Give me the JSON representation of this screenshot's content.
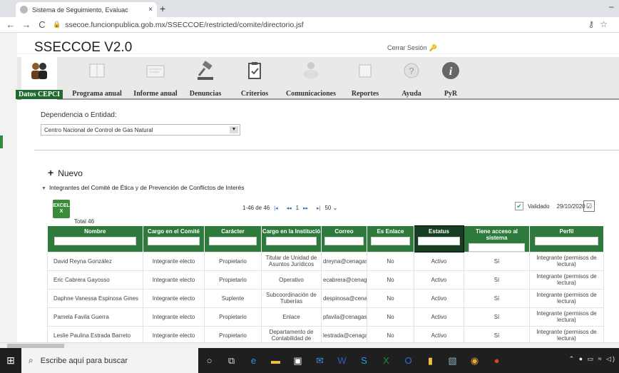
{
  "browser": {
    "tab_title": "Sistema de Seguimiento, Evaluac",
    "tab_close": "×",
    "new_tab": "+",
    "url": "ssecoe.funcionpublica.gob.mx/SSECCOE/restricted/comite/directorio.jsf",
    "window_min": "–"
  },
  "app": {
    "title": "SSECCOE V2.0",
    "logout": "Cerrar Sesión"
  },
  "menu": [
    {
      "label": "Datos CEPCI",
      "icon": "people-icon",
      "selected": true
    },
    {
      "label": "Programa anual",
      "icon": "book-icon"
    },
    {
      "label": "Informe anual",
      "icon": "report-icon"
    },
    {
      "label": "Denuncias",
      "icon": "gavel-icon"
    },
    {
      "label": "Criterios",
      "icon": "clipboard-icon"
    },
    {
      "label": "Comunicaciones",
      "icon": "handshake-icon"
    },
    {
      "label": "Reportes",
      "icon": "folder-icon"
    },
    {
      "label": "Ayuda",
      "icon": "help-icon"
    },
    {
      "label": "PyR",
      "icon": "info-icon"
    }
  ],
  "dependency": {
    "label": "Dependencia o Entidad:",
    "value": "Centro Nacional de Control de Gas Natural"
  },
  "nuevo": "Nuevo",
  "section_title": "Integrantes del Comité de Ética y de Prevención de Conflictos de Interés",
  "excel": {
    "label": "EXCEL",
    "total": "Total 46"
  },
  "pager": {
    "range": "1-46 de 46",
    "first": "|◂",
    "prev": "◂◂",
    "page": "1",
    "next": "▸▸",
    "last": "▸|",
    "per_page": "50"
  },
  "validado": {
    "label": "Validado",
    "date": "29/10/2020",
    "checked": "✔"
  },
  "columns": [
    "Nombre",
    "Cargo en el Comité",
    "Carácter",
    "Cargo en la Institució",
    "Correo",
    "Es Enlace",
    "Estatus",
    "Tiene acceso al sistema",
    "Perfil"
  ],
  "rows": [
    [
      "David Reyna González",
      "Integrante electo",
      "Propietario",
      "Titular de Unidad de Asuntos Jurídicos",
      "dreyna@cenagas.gob",
      "No",
      "Activo",
      "Sí",
      "Integrante (permisos de lectura)"
    ],
    [
      "Eric Cabrera Gayosso",
      "Integrante electo",
      "Propietario",
      "Operativo",
      "ecabrera@cenagas.g",
      "No",
      "Activo",
      "Sí",
      "Integrante (permisos de lectura)"
    ],
    [
      "Daphne Vanessa Espinosa Gines",
      "Integrante electo",
      "Suplente",
      "Subcoordinación de Tuberías",
      "despinosa@cenagas",
      "No",
      "Activo",
      "Sí",
      "Integrante (permisos de lectura)"
    ],
    [
      "Pamela Favila Guerra",
      "Integrante electo",
      "Propietario",
      "Enlace",
      "pfavila@cenagas.gob",
      "No",
      "Activo",
      "Sí",
      "Integrante (permisos de lectura)"
    ],
    [
      "Leslie Paulina Estrada Barreto",
      "Integrante electo",
      "Propietario",
      "Departamento de Contabilidad de",
      "lestrada@cenagas.g",
      "No",
      "Activo",
      "Sí",
      "Integrante (permisos de lectura)"
    ]
  ],
  "taskbar": {
    "search_placeholder": "Escribe aquí para buscar"
  },
  "colors": {
    "brand_green": "#2e7a3c",
    "menu_selected": "#1f6b2d"
  }
}
